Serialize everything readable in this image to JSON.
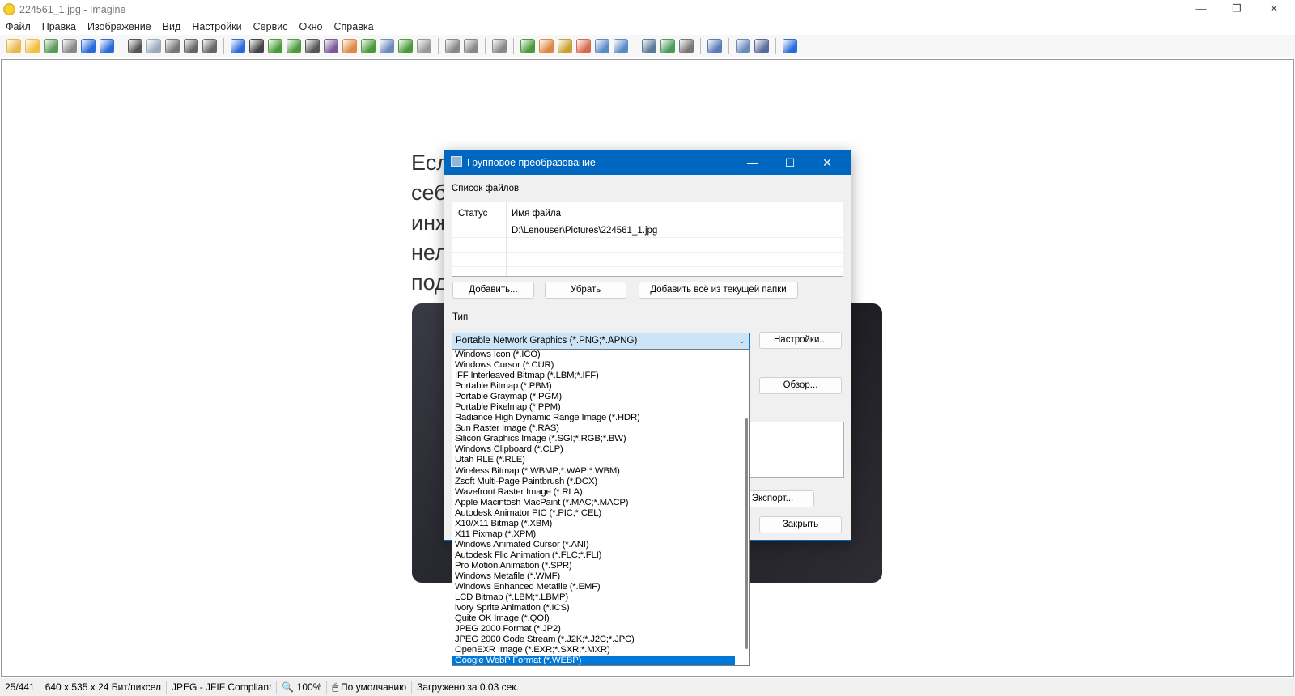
{
  "window": {
    "title": "224561_1.jpg - Imagine",
    "minimize": "—",
    "restore": "❐",
    "close": "✕"
  },
  "menu": [
    "Файл",
    "Правка",
    "Изображение",
    "Вид",
    "Настройки",
    "Сервис",
    "Окно",
    "Справка"
  ],
  "toolbar": {
    "icons": [
      {
        "name": "new-icon",
        "color": "#e8b84a"
      },
      {
        "name": "open-folder-icon",
        "color": "#f0c040"
      },
      {
        "name": "save-icon",
        "color": "#5a9a5a"
      },
      {
        "name": "print-icon",
        "color": "#888"
      },
      {
        "name": "back-arrow-icon",
        "color": "#2a6ad8"
      },
      {
        "name": "forward-arrow-icon",
        "color": "#2a6ad8"
      },
      "sep",
      {
        "name": "cut-icon",
        "color": "#555"
      },
      {
        "name": "copy-icon",
        "color": "#9ab"
      },
      {
        "name": "paste-icon",
        "color": "#777"
      },
      {
        "name": "undo-icon",
        "color": "#666"
      },
      {
        "name": "redo-icon",
        "color": "#666"
      },
      "sep",
      {
        "name": "info-icon",
        "color": "#2a6ad8"
      },
      {
        "name": "camera-icon",
        "color": "#444"
      },
      {
        "name": "resize-icon",
        "color": "#4a9a3a"
      },
      {
        "name": "scanner-icon",
        "color": "#4a9a3a"
      },
      {
        "name": "gradient-icon",
        "color": "#555"
      },
      {
        "name": "color-adjust-icon",
        "color": "#7a5a9a"
      },
      {
        "name": "palette-icon",
        "color": "#d84"
      },
      {
        "name": "export-arrow-icon",
        "color": "#4a9a3a"
      },
      {
        "name": "crop-icon",
        "color": "#6a8ab8"
      },
      {
        "name": "rotate-icon",
        "color": "#4a9a3a"
      },
      {
        "name": "effects-icon",
        "color": "#999"
      },
      "sep",
      {
        "name": "zoom-in-icon",
        "color": "#888"
      },
      {
        "name": "zoom-out-icon",
        "color": "#888"
      },
      "sep",
      {
        "name": "refresh-icon",
        "color": "#888"
      },
      "sep",
      {
        "name": "prev-image-icon",
        "color": "#4a9a3a"
      },
      {
        "name": "next-image-icon",
        "color": "#d84"
      },
      {
        "name": "magic-wand-icon",
        "color": "#c9a030"
      },
      {
        "name": "fit-window-icon",
        "color": "#d86a4a"
      },
      {
        "name": "actual-size-icon",
        "color": "#5a8ac8"
      },
      {
        "name": "fullscreen-icon",
        "color": "#5a8ac8"
      },
      "sep",
      {
        "name": "monitor-icon",
        "color": "#5a7a9a"
      },
      {
        "name": "slideshow-icon",
        "color": "#4a9a5a"
      },
      {
        "name": "tools-icon",
        "color": "#777"
      },
      "sep",
      {
        "name": "settings-wrench-icon",
        "color": "#5a7ab8"
      },
      "sep",
      {
        "name": "batch-convert-icon",
        "color": "#6a8ab8"
      },
      {
        "name": "plugin-icon",
        "color": "#5a6a9a"
      },
      "sep",
      {
        "name": "help-icon",
        "color": "#2a6ad8"
      }
    ]
  },
  "background": {
    "text_lines": [
      "Есл",
      "себ",
      "инж",
      "нел",
      "под"
    ]
  },
  "dialog": {
    "title": "Групповое преобразование",
    "file_list_label": "Список файлов",
    "columns": [
      "Статус",
      "Имя файла"
    ],
    "files": [
      {
        "status": "",
        "name": "D:\\Lenouser\\Pictures\\224561_1.jpg"
      }
    ],
    "add_button": "Добавить...",
    "remove_button": "Убрать",
    "add_all_button": "Добавить всё из текущей папки",
    "type_label": "Тип",
    "type_selected": "Portable Network Graphics (*.PNG;*.APNG)",
    "settings_button": "Настройки...",
    "browse_button": "Обзор...",
    "export_button": "Экспорт...",
    "close_button": "Закрыть",
    "type_options": [
      "Windows Icon (*.ICO)",
      "Windows Cursor (*.CUR)",
      "IFF Interleaved Bitmap (*.LBM;*.IFF)",
      "Portable Bitmap (*.PBM)",
      "Portable Graymap (*.PGM)",
      "Portable Pixelmap (*.PPM)",
      "Radiance High Dynamic Range Image (*.HDR)",
      "Sun Raster Image (*.RAS)",
      "Silicon Graphics Image (*.SGI;*.RGB;*.BW)",
      "Windows Clipboard (*.CLP)",
      "Utah RLE (*.RLE)",
      "Wireless Bitmap (*.WBMP;*.WAP;*.WBM)",
      "Zsoft Multi-Page Paintbrush (*.DCX)",
      "Wavefront Raster Image (*.RLA)",
      "Apple Macintosh MacPaint (*.MAC;*.MACP)",
      "Autodesk Animator PIC (*.PIC;*.CEL)",
      "X10/X11 Bitmap (*.XBM)",
      "X11 Pixmap (*.XPM)",
      "Windows Animated Cursor (*.ANI)",
      "Autodesk Flic Animation (*.FLC;*.FLI)",
      "Pro Motion Animation (*.SPR)",
      "Windows Metafile (*.WMF)",
      "Windows Enhanced Metafile (*.EMF)",
      "LCD Bitmap (*.LBM;*.LBMP)",
      "ivory Sprite Animation (*.ICS)",
      "Quite OK Image (*.QOI)",
      "JPEG 2000 Format (*.JP2)",
      "JPEG 2000 Code Stream (*.J2K;*.J2C;*.JPC)",
      "OpenEXR Image (*.EXR;*.SXR;*.MXR)",
      "Google WebP Format (*.WEBP)"
    ],
    "highlighted_option": "Google WebP Format (*.WEBP)",
    "accent": "#0067c0"
  },
  "status": {
    "index": "25/441",
    "dimensions": "640 x 535 x 24 Бит/пиксел",
    "format": "JPEG - JFIF Compliant",
    "zoom": "100%",
    "mode": "По умолчанию",
    "load_time": "Загружено за 0.03 сек."
  }
}
